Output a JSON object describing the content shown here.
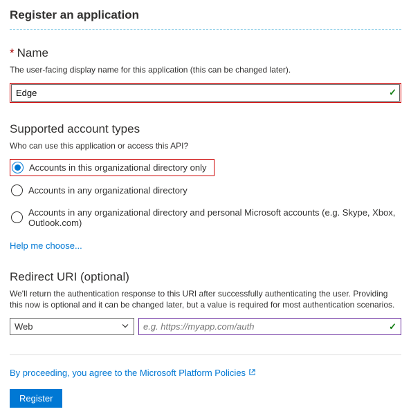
{
  "page_title": "Register an application",
  "name_section": {
    "heading": "Name",
    "helper": "The user-facing display name for this application (this can be changed later).",
    "value": "Edge"
  },
  "account_types_section": {
    "heading": "Supported account types",
    "helper": "Who can use this application or access this API?",
    "options": [
      {
        "label": "Accounts in this organizational directory only"
      },
      {
        "label": "Accounts in any organizational directory"
      },
      {
        "label": "Accounts in any organizational directory and personal Microsoft accounts (e.g. Skype, Xbox, Outlook.com)"
      }
    ],
    "help_link": "Help me choose..."
  },
  "redirect_section": {
    "heading": "Redirect URI (optional)",
    "helper": "We'll return the authentication response to this URI after successfully authenticating the user. Providing this now is optional and it can be changed later, but a value is required for most authentication scenarios.",
    "type_selected": "Web",
    "uri_placeholder": "e.g. https://myapp.com/auth"
  },
  "footer": {
    "policy_text": "By proceeding, you agree to the Microsoft Platform Policies",
    "register_label": "Register"
  }
}
